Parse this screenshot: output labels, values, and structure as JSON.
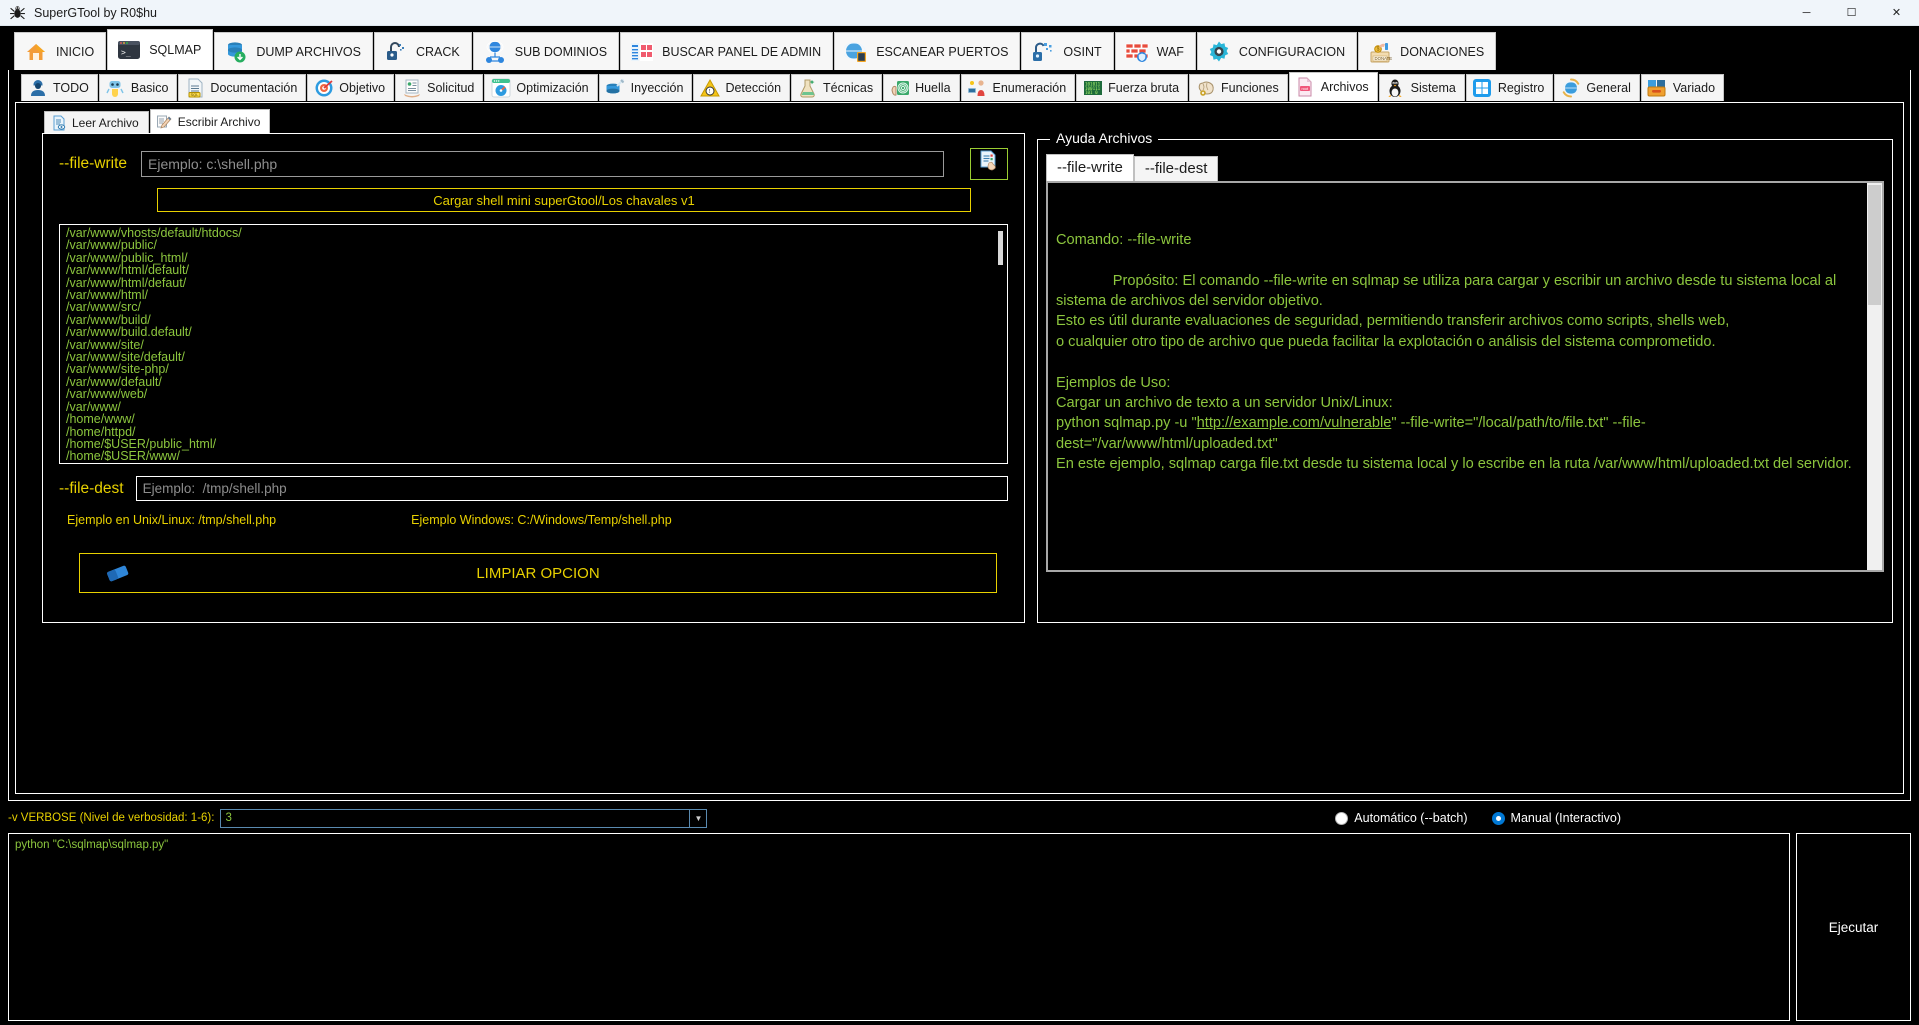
{
  "window": {
    "title": "SuperGTool by R0$hu",
    "app_icon": "spider-icon",
    "minimize": "─",
    "maximize": "☐",
    "close": "✕"
  },
  "main_toolbar": [
    {
      "label": "INICIO",
      "icon": "house-icon",
      "active": false
    },
    {
      "label": "SQLMAP",
      "icon": "terminal-icon",
      "active": true
    },
    {
      "label": "DUMP ARCHIVOS",
      "icon": "database-download-icon",
      "active": false
    },
    {
      "label": "CRACK",
      "icon": "open-padlock-icon",
      "active": false
    },
    {
      "label": "SUB DOMINIOS",
      "icon": "globe-network-icon",
      "active": false
    },
    {
      "label": "BUSCAR PANEL DE ADMIN",
      "icon": "admin-panel-icon",
      "active": false
    },
    {
      "label": "ESCANEAR PUERTOS",
      "icon": "globe-scan-icon",
      "active": false
    },
    {
      "label": "OSINT",
      "icon": "padlock-data-icon",
      "active": false
    },
    {
      "label": "WAF",
      "icon": "firewall-icon",
      "active": false
    },
    {
      "label": "CONFIGURACION",
      "icon": "gear-icon",
      "active": false
    },
    {
      "label": "DONACIONES",
      "icon": "donate-box-icon",
      "active": false
    }
  ],
  "sub_toolbar": [
    {
      "label": "TODO",
      "icon": "hacker-icon",
      "active": false
    },
    {
      "label": "Basico",
      "icon": "robot-icon",
      "active": false
    },
    {
      "label": "Documentación",
      "icon": "sql-doc-icon",
      "active": false
    },
    {
      "label": "Objetivo",
      "icon": "target-icon",
      "active": false
    },
    {
      "label": "Solicitud",
      "icon": "request-form-icon",
      "active": false
    },
    {
      "label": "Optimización",
      "icon": "speedometer-icon",
      "active": false
    },
    {
      "label": "Inyección",
      "icon": "database-syringe-icon",
      "active": false
    },
    {
      "label": "Detección",
      "icon": "warning-radar-icon",
      "active": false
    },
    {
      "label": "Técnicas",
      "icon": "flask-icon",
      "active": false
    },
    {
      "label": "Huella",
      "icon": "fingerprint-icon",
      "active": false
    },
    {
      "label": "Enumeración",
      "icon": "enumeration-icon",
      "active": false
    },
    {
      "label": "Fuerza bruta",
      "icon": "binary-icon",
      "active": false
    },
    {
      "label": "Funciones",
      "icon": "brain-gear-icon",
      "active": false
    },
    {
      "label": "Archivos",
      "icon": "root-file-icon",
      "active": true
    },
    {
      "label": "Sistema",
      "icon": "linux-penguin-icon",
      "active": false
    },
    {
      "label": "Registro",
      "icon": "windows-icon",
      "active": false
    },
    {
      "label": "General",
      "icon": "globe-gear-icon",
      "active": false
    },
    {
      "label": "Variado",
      "icon": "toolbox-icon",
      "active": false
    }
  ],
  "leaf_tabs": [
    {
      "label": "Leer Archivo",
      "icon": "read-file-icon",
      "active": false
    },
    {
      "label": "Escribir Archivo",
      "icon": "write-file-icon",
      "active": true
    }
  ],
  "file_write": {
    "label": "--file-write",
    "input_value": "",
    "input_placeholder": "Ejemplo: c:\\shell.php",
    "browse_icon": "browse-file-icon",
    "load_shell_label": "Cargar shell mini superGtool/Los chavales v1"
  },
  "paths": [
    "/var/www/vhosts/default/htdocs/",
    "/var/www/public/",
    "/var/www/public_html/",
    "/var/www/html/default/",
    "/var/www/html/defaut/",
    "/var/www/html/",
    "/var/www/src/",
    "/var/www/build/",
    "/var/www/build.default/",
    "/var/www/site/",
    "/var/www/site/default/",
    "/var/www/site-php/",
    "/var/www/default/",
    "/var/www/web/",
    "/var/www/",
    "/home/www/",
    "/home/httpd/",
    "/home/$USER/public_html/",
    "/home/$USER/www/"
  ],
  "file_dest": {
    "label": "--file-dest",
    "input_value": "",
    "input_placeholder": "Ejemplo:  /tmp/shell.php",
    "example_unix": "Ejemplo en Unix/Linux: /tmp/shell.php",
    "example_windows": "Ejemplo Windows: C:/Windows/Temp/shell.php"
  },
  "clear_button": {
    "label": "LIMPIAR OPCION",
    "icon": "eraser-icon"
  },
  "help": {
    "group_title": "Ayuda Archivos",
    "tabs": [
      {
        "label": "--file-write",
        "active": true
      },
      {
        "label": "--file-dest",
        "active": false
      }
    ],
    "heading": "Comando: --file-write",
    "body_before_link": "Propósito: El comando --file-write en sqlmap se utiliza para cargar y escribir un archivo desde tu sistema local al sistema de archivos del servidor objetivo.\nEsto es útil durante evaluaciones de seguridad, permitiendo transferir archivos como scripts, shells web,\no cualquier otro tipo de archivo que pueda facilitar la explotación o análisis del sistema comprometido.\n\nEjemplos de Uso:\nCargar un archivo de texto a un servidor Unix/Linux:\npython sqlmap.py -u \"",
    "link_text": "http://example.com/vulnerable",
    "body_after_link": "\" --file-write=\"/local/path/to/file.txt\" --file-dest=\"/var/www/html/uploaded.txt\"\nEn este ejemplo, sqlmap carga file.txt desde tu sistema local y lo escribe en la ruta /var/www/html/uploaded.txt del servidor."
  },
  "verbose": {
    "label": "-v VERBOSE (Nivel de verbosidad: 1-6):",
    "value": "3",
    "arrow_icon": "chevron-down-icon"
  },
  "mode": {
    "options": [
      {
        "label": "Automático (--batch)",
        "selected": false
      },
      {
        "label": "Manual (Interactivo)",
        "selected": true
      }
    ],
    "accent_color": "#0078d4"
  },
  "console": {
    "text": "python \"C:\\sqlmap\\sqlmap.py\""
  },
  "execute_button": {
    "label": "Ejecutar"
  },
  "colors": {
    "background": "#000000",
    "yellow": "#e8d100",
    "green": "#8cc63e",
    "white": "#ffffff",
    "accent": "#0078d4"
  }
}
